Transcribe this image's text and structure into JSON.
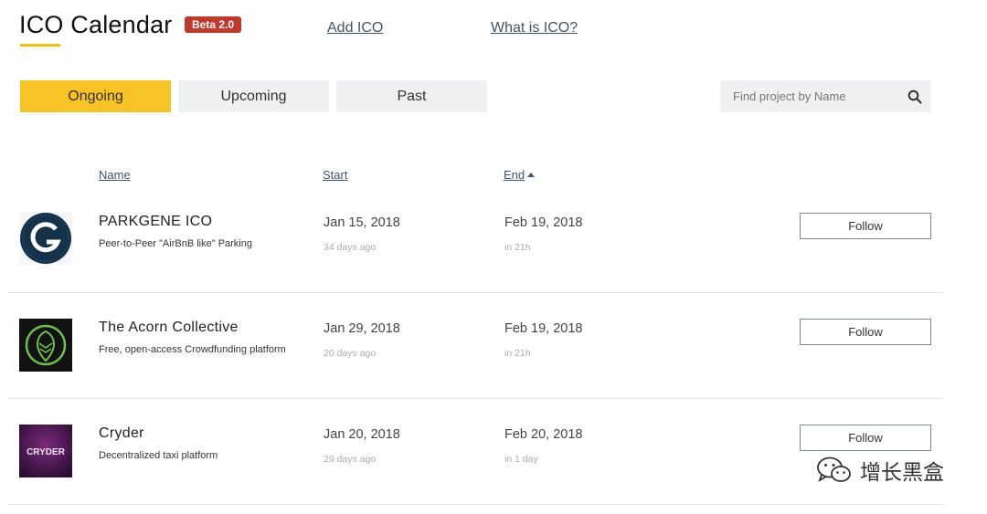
{
  "header": {
    "title": "ICO Calendar",
    "badge": "Beta 2.0",
    "links": [
      "Add ICO",
      "What is ICO?"
    ]
  },
  "tabs": [
    {
      "label": "Ongoing",
      "active": true
    },
    {
      "label": "Upcoming",
      "active": false
    },
    {
      "label": "Past",
      "active": false
    }
  ],
  "search": {
    "placeholder": "Find project by Name",
    "value": ""
  },
  "columns": {
    "name": "Name",
    "start": "Start",
    "end": "End"
  },
  "rows": [
    {
      "name": "PARKGENE ICO",
      "description": "Peer-to-Peer \"AirBnB like\" Parking",
      "start": "Jan 15, 2018",
      "start_rel": "34 days ago",
      "end": "Feb 19, 2018",
      "end_rel": "in 21h",
      "follow": "Follow",
      "logo_text": ""
    },
    {
      "name": "The Acorn Collective",
      "description": "Free, open-access Crowdfunding platform",
      "start": "Jan 29, 2018",
      "start_rel": "20 days ago",
      "end": "Feb 19, 2018",
      "end_rel": "in 21h",
      "follow": "Follow",
      "logo_text": ""
    },
    {
      "name": "Cryder",
      "description": "Decentralized taxi platform",
      "start": "Jan 20, 2018",
      "start_rel": "29 days ago",
      "end": "Feb 20, 2018",
      "end_rel": "in 1 day",
      "follow": "Follow",
      "logo_text": "CRYDER"
    }
  ],
  "watermark": {
    "text": "增长黑盒"
  },
  "colors": {
    "accent": "#f7c325",
    "badge": "#c0392b",
    "link": "#445566"
  }
}
